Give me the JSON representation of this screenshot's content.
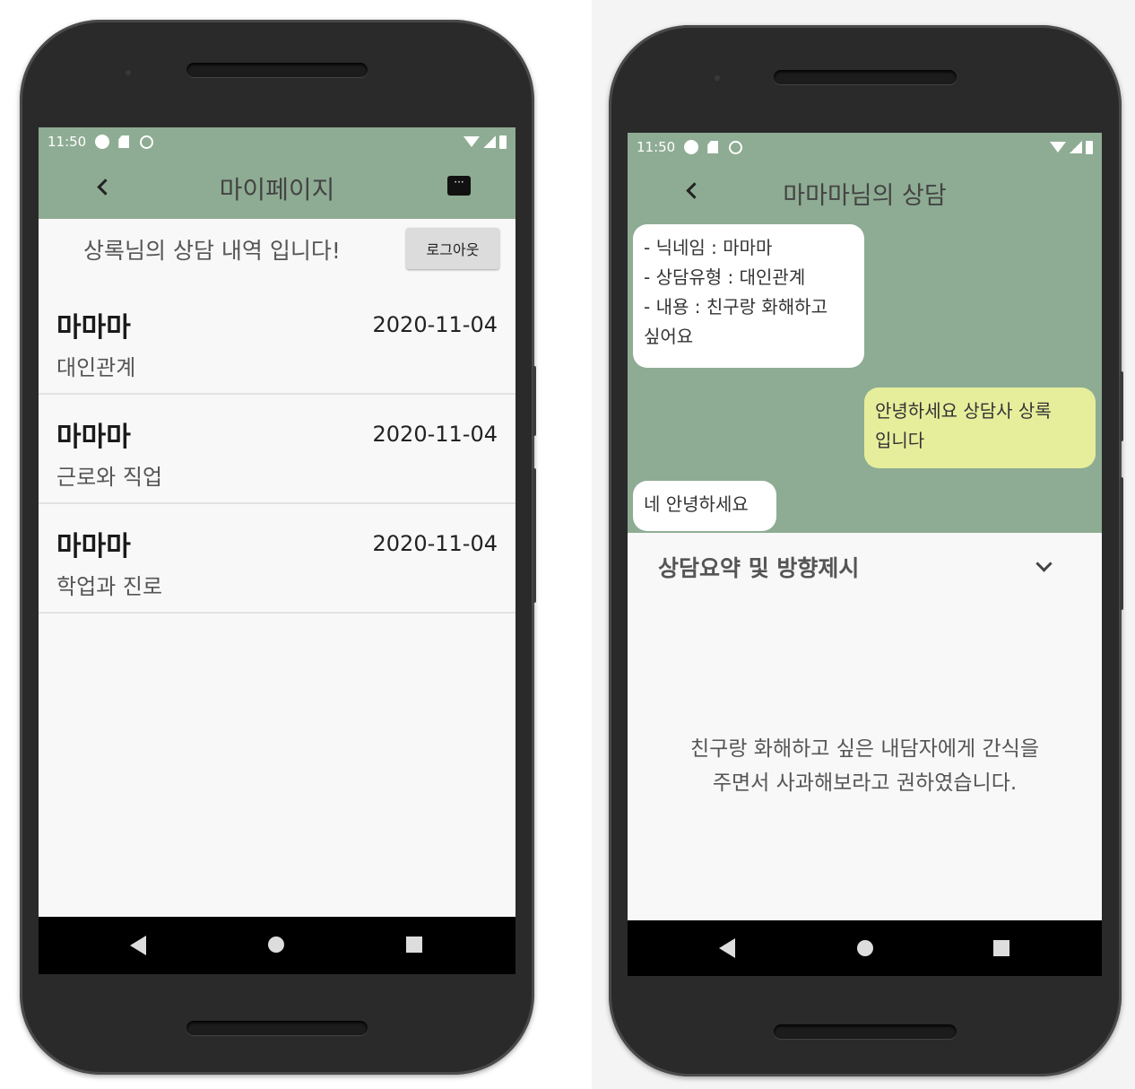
{
  "colors": {
    "app_green": "#8eac93",
    "bubble_white": "#ffffff",
    "bubble_yellow": "#e6ee9c",
    "nav_black": "#000000"
  },
  "status_bar": {
    "time": "11:50"
  },
  "left_phone": {
    "title": "마이페이지",
    "greeting": "상록님의 상담 내역 입니다!",
    "logout_label": "로그아웃",
    "items": [
      {
        "name": "마마마",
        "date": "2020-11-04",
        "type": "대인관계"
      },
      {
        "name": "마마마",
        "date": "2020-11-04",
        "type": "근로와 직업"
      },
      {
        "name": "마마마",
        "date": "2020-11-04",
        "type": "학업과 진로"
      }
    ]
  },
  "right_phone": {
    "title": "마마마님의 상담",
    "messages": [
      {
        "side": "left",
        "lines": [
          "- 닉네임 : 마마마",
          "- 상담유형 : 대인관계",
          "- 내용 : 친구랑 화해하고",
          "싶어요"
        ]
      },
      {
        "side": "right",
        "lines": [
          "안녕하세요 상담사 상록",
          "입니다"
        ]
      },
      {
        "side": "left",
        "lines": [
          "네 안녕하세요"
        ]
      }
    ],
    "summary_header": "상담요약 및 방향제시",
    "summary_lines": [
      "친구랑 화해하고 싶은 내담자에게 간식을",
      "주면서 사과해보라고 권하였습니다."
    ]
  }
}
